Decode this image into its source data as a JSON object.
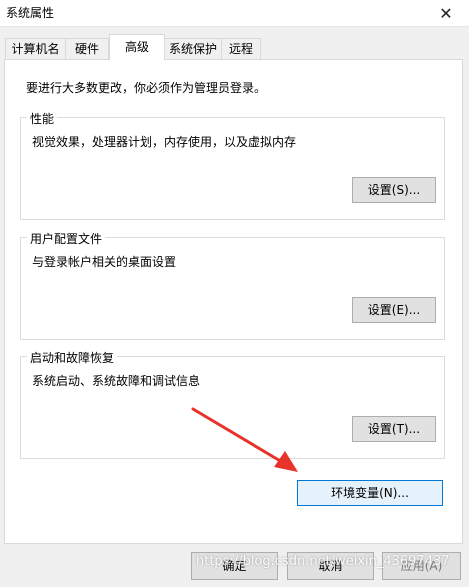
{
  "window": {
    "title": "系统属性"
  },
  "tabs": [
    {
      "label": "计算机名"
    },
    {
      "label": "硬件"
    },
    {
      "label": "高级"
    },
    {
      "label": "系统保护"
    },
    {
      "label": "远程"
    }
  ],
  "admin_note": "要进行大多数更改，你必须作为管理员登录。",
  "groups": {
    "performance": {
      "title": "性能",
      "desc": "视觉效果，处理器计划，内存使用，以及虚拟内存",
      "button": "设置(S)..."
    },
    "profiles": {
      "title": "用户配置文件",
      "desc": "与登录帐户相关的桌面设置",
      "button": "设置(E)..."
    },
    "startup": {
      "title": "启动和故障恢复",
      "desc": "系统启动、系统故障和调试信息",
      "button": "设置(T)..."
    }
  },
  "env_button": "环境变量(N)...",
  "footer": {
    "ok": "确定",
    "cancel": "取消",
    "apply": "应用(A)"
  },
  "watermark": "https://blog.csdn.net/weixin_43697437",
  "colors": {
    "arrow": "#e8332a",
    "focus_border": "#0078d7"
  }
}
